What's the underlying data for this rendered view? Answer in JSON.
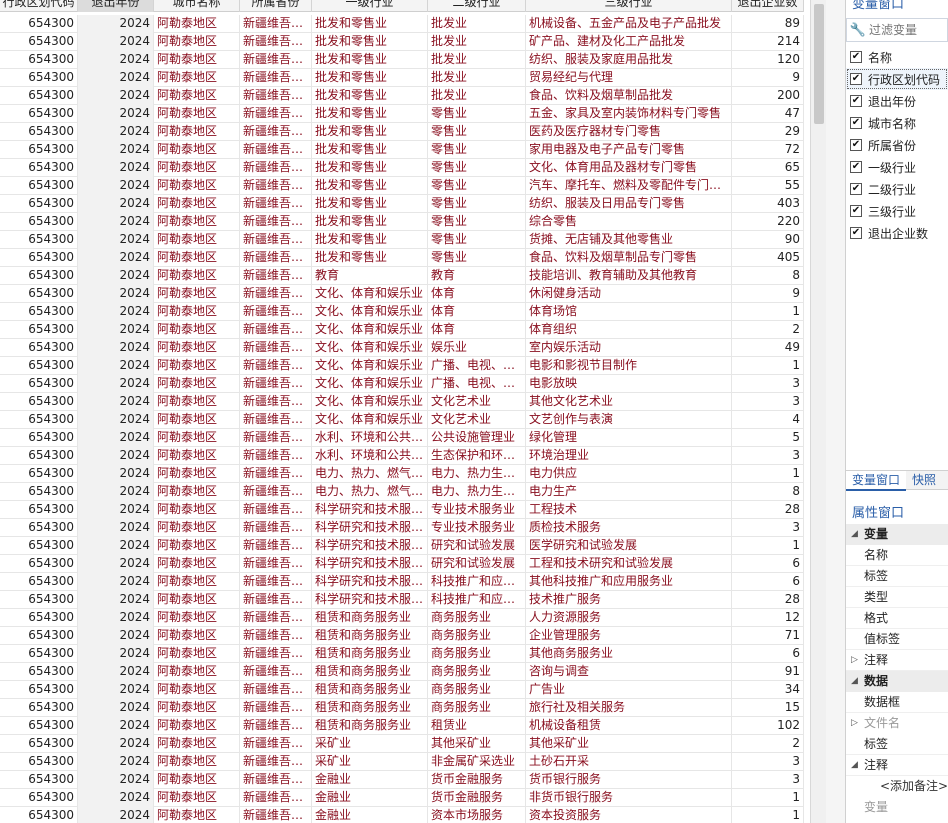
{
  "columns": [
    "行政区划代码",
    "退出年份",
    "城市名称",
    "所属省份",
    "一级行业",
    "二级行业",
    "三级行业",
    "退出企业数"
  ],
  "rows": [
    [
      "654300",
      "2024",
      "阿勒泰地区",
      "新疆维吾尔自治区",
      "批发和零售业",
      "批发业",
      "机械设备、五金产品及电子产品批发",
      "89"
    ],
    [
      "654300",
      "2024",
      "阿勒泰地区",
      "新疆维吾尔自治区",
      "批发和零售业",
      "批发业",
      "矿产品、建材及化工产品批发",
      "214"
    ],
    [
      "654300",
      "2024",
      "阿勒泰地区",
      "新疆维吾尔自治区",
      "批发和零售业",
      "批发业",
      "纺织、服装及家庭用品批发",
      "120"
    ],
    [
      "654300",
      "2024",
      "阿勒泰地区",
      "新疆维吾尔自治区",
      "批发和零售业",
      "批发业",
      "贸易经纪与代理",
      "9"
    ],
    [
      "654300",
      "2024",
      "阿勒泰地区",
      "新疆维吾尔自治区",
      "批发和零售业",
      "批发业",
      "食品、饮料及烟草制品批发",
      "200"
    ],
    [
      "654300",
      "2024",
      "阿勒泰地区",
      "新疆维吾尔自治区",
      "批发和零售业",
      "零售业",
      "五金、家具及室内装饰材料专门零售",
      "47"
    ],
    [
      "654300",
      "2024",
      "阿勒泰地区",
      "新疆维吾尔自治区",
      "批发和零售业",
      "零售业",
      "医药及医疗器材专门零售",
      "29"
    ],
    [
      "654300",
      "2024",
      "阿勒泰地区",
      "新疆维吾尔自治区",
      "批发和零售业",
      "零售业",
      "家用电器及电子产品专门零售",
      "72"
    ],
    [
      "654300",
      "2024",
      "阿勒泰地区",
      "新疆维吾尔自治区",
      "批发和零售业",
      "零售业",
      "文化、体育用品及器材专门零售",
      "65"
    ],
    [
      "654300",
      "2024",
      "阿勒泰地区",
      "新疆维吾尔自治区",
      "批发和零售业",
      "零售业",
      "汽车、摩托车、燃料及零配件专门零售",
      "55"
    ],
    [
      "654300",
      "2024",
      "阿勒泰地区",
      "新疆维吾尔自治区",
      "批发和零售业",
      "零售业",
      "纺织、服装及日用品专门零售",
      "403"
    ],
    [
      "654300",
      "2024",
      "阿勒泰地区",
      "新疆维吾尔自治区",
      "批发和零售业",
      "零售业",
      "综合零售",
      "220"
    ],
    [
      "654300",
      "2024",
      "阿勒泰地区",
      "新疆维吾尔自治区",
      "批发和零售业",
      "零售业",
      "货摊、无店铺及其他零售业",
      "90"
    ],
    [
      "654300",
      "2024",
      "阿勒泰地区",
      "新疆维吾尔自治区",
      "批发和零售业",
      "零售业",
      "食品、饮料及烟草制品专门零售",
      "405"
    ],
    [
      "654300",
      "2024",
      "阿勒泰地区",
      "新疆维吾尔自治区",
      "教育",
      "教育",
      "技能培训、教育辅助及其他教育",
      "8"
    ],
    [
      "654300",
      "2024",
      "阿勒泰地区",
      "新疆维吾尔自治区",
      "文化、体育和娱乐业",
      "体育",
      "休闲健身活动",
      "9"
    ],
    [
      "654300",
      "2024",
      "阿勒泰地区",
      "新疆维吾尔自治区",
      "文化、体育和娱乐业",
      "体育",
      "体育场馆",
      "1"
    ],
    [
      "654300",
      "2024",
      "阿勒泰地区",
      "新疆维吾尔自治区",
      "文化、体育和娱乐业",
      "体育",
      "体育组织",
      "2"
    ],
    [
      "654300",
      "2024",
      "阿勒泰地区",
      "新疆维吾尔自治区",
      "文化、体育和娱乐业",
      "娱乐业",
      "室内娱乐活动",
      "49"
    ],
    [
      "654300",
      "2024",
      "阿勒泰地区",
      "新疆维吾尔自治区",
      "文化、体育和娱乐业",
      "广播、电视、电影和录音制作业",
      "电影和影视节目制作",
      "1"
    ],
    [
      "654300",
      "2024",
      "阿勒泰地区",
      "新疆维吾尔自治区",
      "文化、体育和娱乐业",
      "广播、电视、电影和录音制作业",
      "电影放映",
      "3"
    ],
    [
      "654300",
      "2024",
      "阿勒泰地区",
      "新疆维吾尔自治区",
      "文化、体育和娱乐业",
      "文化艺术业",
      "其他文化艺术业",
      "3"
    ],
    [
      "654300",
      "2024",
      "阿勒泰地区",
      "新疆维吾尔自治区",
      "文化、体育和娱乐业",
      "文化艺术业",
      "文艺创作与表演",
      "4"
    ],
    [
      "654300",
      "2024",
      "阿勒泰地区",
      "新疆维吾尔自治区",
      "水利、环境和公共设施管理业",
      "公共设施管理业",
      "绿化管理",
      "5"
    ],
    [
      "654300",
      "2024",
      "阿勒泰地区",
      "新疆维吾尔自治区",
      "水利、环境和公共设施管理业",
      "生态保护和环境治理业",
      "环境治理业",
      "3"
    ],
    [
      "654300",
      "2024",
      "阿勒泰地区",
      "新疆维吾尔自治区",
      "电力、热力、燃气及水生产和供应业",
      "电力、热力生产和供应业",
      "电力供应",
      "1"
    ],
    [
      "654300",
      "2024",
      "阿勒泰地区",
      "新疆维吾尔自治区",
      "电力、热力、燃气及水生产和供应业",
      "电力、热力生产和供应业",
      "电力生产",
      "8"
    ],
    [
      "654300",
      "2024",
      "阿勒泰地区",
      "新疆维吾尔自治区",
      "科学研究和技术服务业",
      "专业技术服务业",
      "工程技术",
      "28"
    ],
    [
      "654300",
      "2024",
      "阿勒泰地区",
      "新疆维吾尔自治区",
      "科学研究和技术服务业",
      "专业技术服务业",
      "质检技术服务",
      "3"
    ],
    [
      "654300",
      "2024",
      "阿勒泰地区",
      "新疆维吾尔自治区",
      "科学研究和技术服务业",
      "研究和试验发展",
      "医学研究和试验发展",
      "1"
    ],
    [
      "654300",
      "2024",
      "阿勒泰地区",
      "新疆维吾尔自治区",
      "科学研究和技术服务业",
      "研究和试验发展",
      "工程和技术研究和试验发展",
      "6"
    ],
    [
      "654300",
      "2024",
      "阿勒泰地区",
      "新疆维吾尔自治区",
      "科学研究和技术服务业",
      "科技推广和应用服务业",
      "其他科技推广和应用服务业",
      "6"
    ],
    [
      "654300",
      "2024",
      "阿勒泰地区",
      "新疆维吾尔自治区",
      "科学研究和技术服务业",
      "科技推广和应用服务业",
      "技术推广服务",
      "28"
    ],
    [
      "654300",
      "2024",
      "阿勒泰地区",
      "新疆维吾尔自治区",
      "租赁和商务服务业",
      "商务服务业",
      "人力资源服务",
      "12"
    ],
    [
      "654300",
      "2024",
      "阿勒泰地区",
      "新疆维吾尔自治区",
      "租赁和商务服务业",
      "商务服务业",
      "企业管理服务",
      "71"
    ],
    [
      "654300",
      "2024",
      "阿勒泰地区",
      "新疆维吾尔自治区",
      "租赁和商务服务业",
      "商务服务业",
      "其他商务服务业",
      "6"
    ],
    [
      "654300",
      "2024",
      "阿勒泰地区",
      "新疆维吾尔自治区",
      "租赁和商务服务业",
      "商务服务业",
      "咨询与调查",
      "91"
    ],
    [
      "654300",
      "2024",
      "阿勒泰地区",
      "新疆维吾尔自治区",
      "租赁和商务服务业",
      "商务服务业",
      "广告业",
      "34"
    ],
    [
      "654300",
      "2024",
      "阿勒泰地区",
      "新疆维吾尔自治区",
      "租赁和商务服务业",
      "商务服务业",
      "旅行社及相关服务",
      "15"
    ],
    [
      "654300",
      "2024",
      "阿勒泰地区",
      "新疆维吾尔自治区",
      "租赁和商务服务业",
      "租赁业",
      "机械设备租赁",
      "102"
    ],
    [
      "654300",
      "2024",
      "阿勒泰地区",
      "新疆维吾尔自治区",
      "采矿业",
      "其他采矿业",
      "其他采矿业",
      "2"
    ],
    [
      "654300",
      "2024",
      "阿勒泰地区",
      "新疆维吾尔自治区",
      "采矿业",
      "非金属矿采选业",
      "土砂石开采",
      "3"
    ],
    [
      "654300",
      "2024",
      "阿勒泰地区",
      "新疆维吾尔自治区",
      "金融业",
      "货币金融服务",
      "货币银行服务",
      "3"
    ],
    [
      "654300",
      "2024",
      "阿勒泰地区",
      "新疆维吾尔自治区",
      "金融业",
      "货币金融服务",
      "非货币银行服务",
      "1"
    ],
    [
      "654300",
      "2024",
      "阿勒泰地区",
      "新疆维吾尔自治区",
      "金融业",
      "资本市场服务",
      "资本投资服务",
      "1"
    ]
  ],
  "panel": {
    "title": "变量窗口",
    "filter_placeholder": "过滤变量",
    "vars": [
      {
        "label": "名称",
        "checked": true
      },
      {
        "label": "行政区划代码",
        "checked": true,
        "selected": true
      },
      {
        "label": "退出年份",
        "checked": true
      },
      {
        "label": "城市名称",
        "checked": true
      },
      {
        "label": "所属省份",
        "checked": true
      },
      {
        "label": "一级行业",
        "checked": true
      },
      {
        "label": "二级行业",
        "checked": true
      },
      {
        "label": "三级行业",
        "checked": true
      },
      {
        "label": "退出企业数",
        "checked": true
      }
    ],
    "tabs": [
      "变量窗口",
      "快照"
    ],
    "props_title": "属性窗口",
    "props": [
      {
        "kind": "grp",
        "label": "变量",
        "tri": "◢"
      },
      {
        "kind": "item",
        "label": "名称"
      },
      {
        "kind": "item",
        "label": "标签"
      },
      {
        "kind": "item",
        "label": "类型"
      },
      {
        "kind": "item",
        "label": "格式"
      },
      {
        "kind": "item",
        "label": "值标签"
      },
      {
        "kind": "item",
        "label": "注释",
        "tri": "▷"
      },
      {
        "kind": "grp",
        "label": "数据",
        "tri": "◢"
      },
      {
        "kind": "item",
        "label": "数据框"
      },
      {
        "kind": "sub",
        "label": "文件名",
        "tri": "▷"
      },
      {
        "kind": "item",
        "label": "标签"
      },
      {
        "kind": "item",
        "label": "注释",
        "tri": "◢"
      },
      {
        "kind": "note",
        "label": "<添加备注>"
      },
      {
        "kind": "sub",
        "label": "变量"
      }
    ]
  },
  "icons": {
    "filter": "wrench-icon",
    "check": "checkmark-icon"
  }
}
